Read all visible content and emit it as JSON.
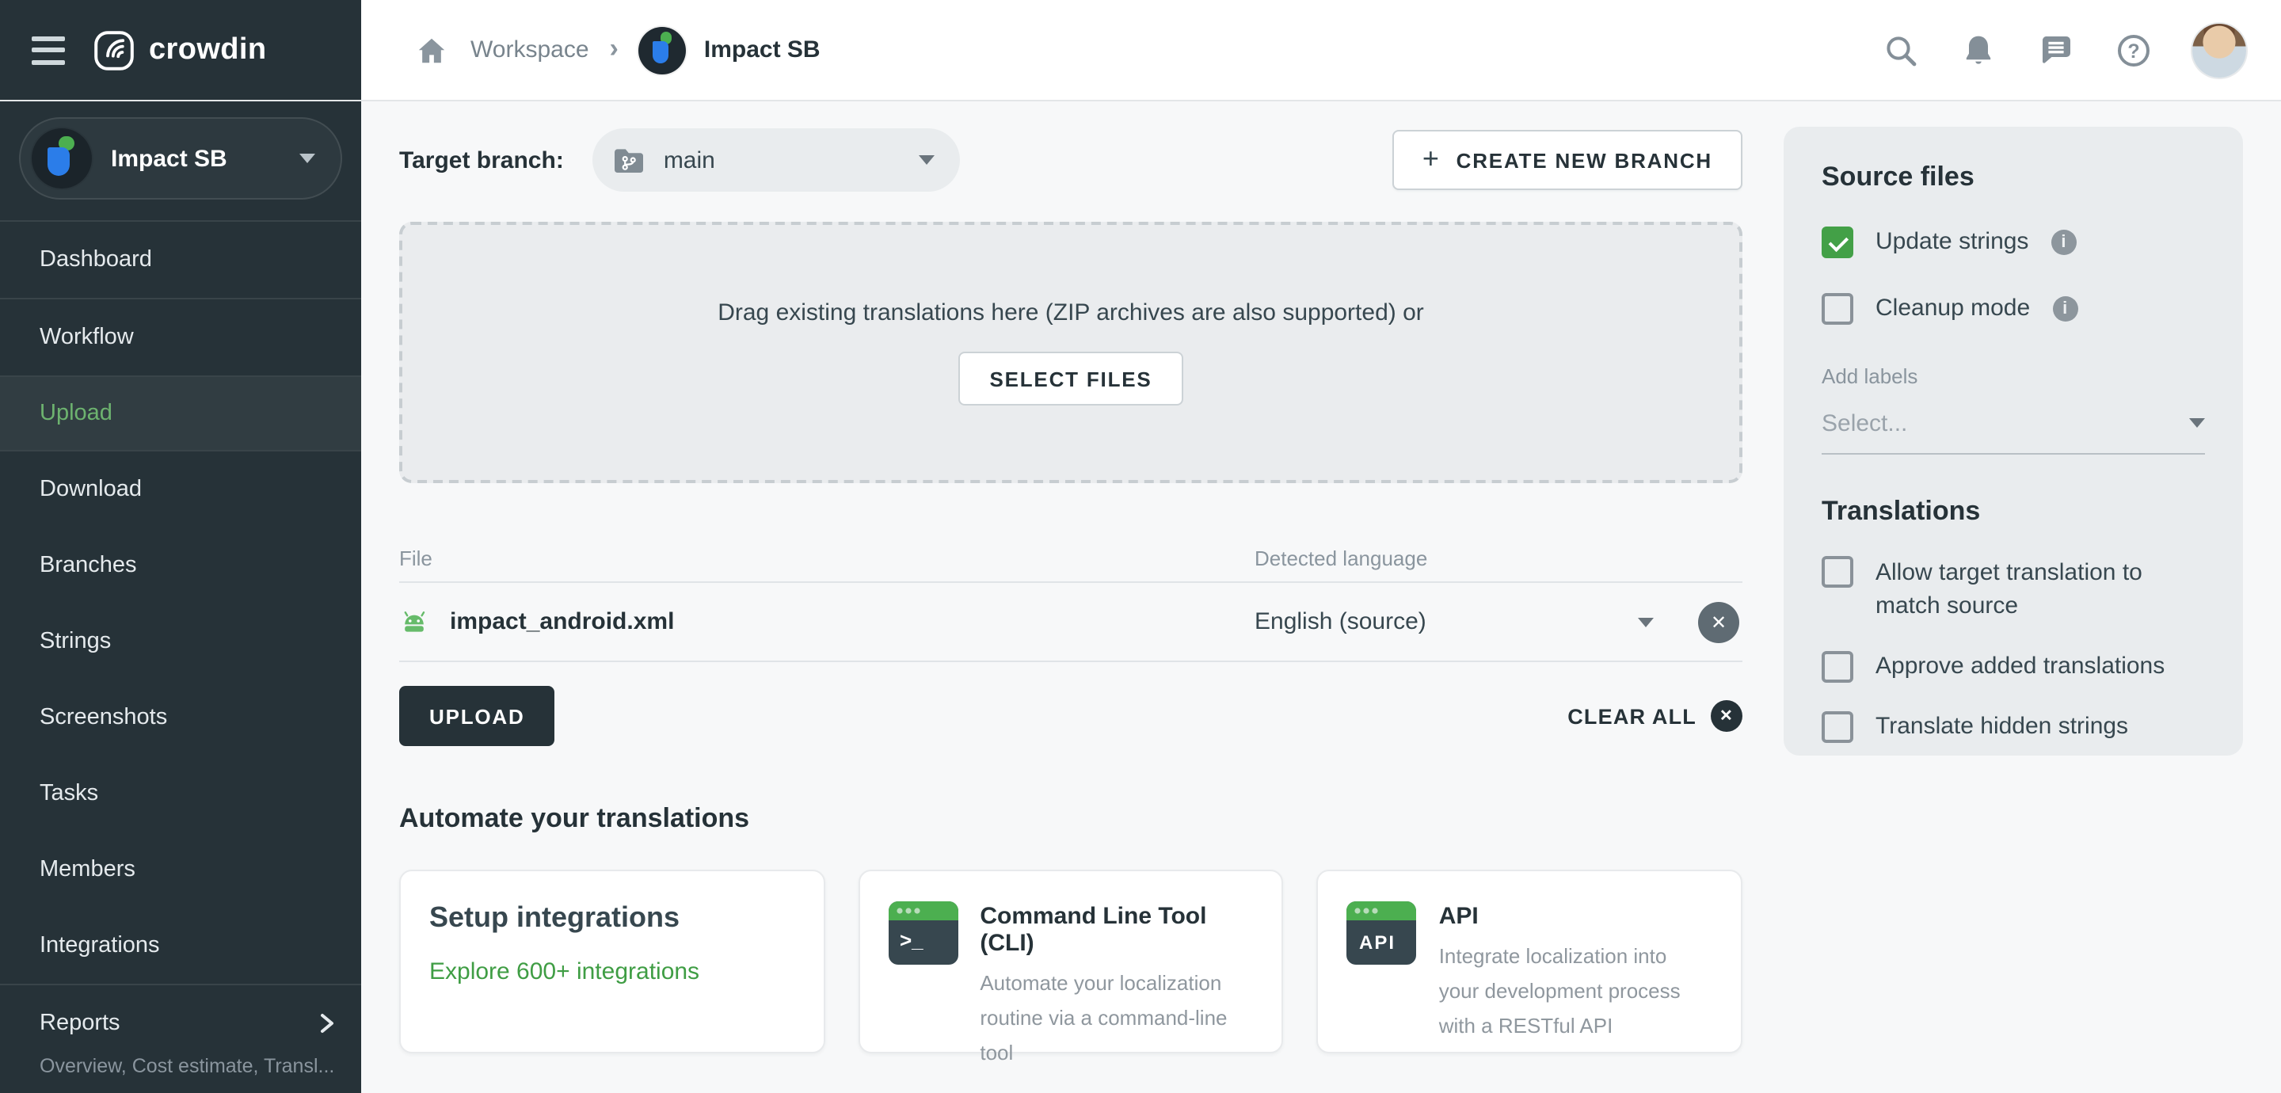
{
  "colors": {
    "dark": "#263238",
    "accent_green": "#43a047",
    "nav_active_green": "#6db36f",
    "link_green": "#3f9d44",
    "panel_bg": "#e9ecee",
    "main_bg": "#f7f8f9",
    "gray_text": "#8a959e"
  },
  "header": {
    "logo_text": "crowdin",
    "breadcrumb": {
      "workspace": "Workspace",
      "project": "Impact SB"
    },
    "icons": {
      "menu-icon": "hamburger",
      "home-icon": "house",
      "search-icon": "magnifier",
      "notifications-icon": "bell",
      "messages-icon": "speech-bubble",
      "help-icon": "question-circle",
      "user-avatar": "photo"
    }
  },
  "sidebar": {
    "project": {
      "name": "Impact SB"
    },
    "items": [
      {
        "label": "Dashboard",
        "active": false
      },
      {
        "label": "Workflow",
        "active": false
      },
      {
        "label": "Upload",
        "active": true
      },
      {
        "label": "Download",
        "active": false
      },
      {
        "label": "Branches",
        "active": false
      },
      {
        "label": "Strings",
        "active": false
      },
      {
        "label": "Screenshots",
        "active": false
      },
      {
        "label": "Tasks",
        "active": false
      },
      {
        "label": "Members",
        "active": false
      },
      {
        "label": "Integrations",
        "active": false
      }
    ],
    "reports": {
      "label": "Reports",
      "subtitle": "Overview, Cost estimate, Transl..."
    }
  },
  "main": {
    "target_branch_label": "Target branch:",
    "branch_select": {
      "value": "main",
      "icon": "branch-folder"
    },
    "create_branch_label": "CREATE NEW BRANCH",
    "create_branch_plus": "+",
    "dropzone": {
      "text": "Drag existing translations here (ZIP archives are also supported) or",
      "button_label": "SELECT FILES"
    },
    "files_table": {
      "col_file": "File",
      "col_language": "Detected language",
      "rows": [
        {
          "file_name": "impact_android.xml",
          "file_icon": "android",
          "language": "English (source)",
          "remove_glyph": "✕"
        }
      ]
    },
    "upload_label": "UPLOAD",
    "clear_all_label": "CLEAR ALL",
    "clear_all_glyph": "✕",
    "automate_heading": "Automate your translations",
    "cards": [
      {
        "title": "Setup integrations",
        "link": "Explore 600+ integrations"
      },
      {
        "title": "Command Line Tool (CLI)",
        "desc": "Automate your localization routine via a command-line tool",
        "icon": "terminal",
        "icon_glyph": ">_"
      },
      {
        "title": "API",
        "desc": "Integrate localization into your development process with a RESTful API",
        "icon": "api-window",
        "icon_glyph": "API"
      }
    ]
  },
  "panel": {
    "source_files_heading": "Source files",
    "options": [
      {
        "label": "Update strings",
        "checked": true,
        "info": true
      },
      {
        "label": "Cleanup mode",
        "checked": false,
        "info": true
      }
    ],
    "add_labels_label": "Add labels",
    "labels_placeholder": "Select...",
    "translations_heading": "Translations",
    "translation_options": [
      {
        "label": "Allow target translation to match source",
        "checked": false
      },
      {
        "label": "Approve added translations",
        "checked": false
      },
      {
        "label": "Translate hidden strings",
        "checked": false
      }
    ]
  }
}
